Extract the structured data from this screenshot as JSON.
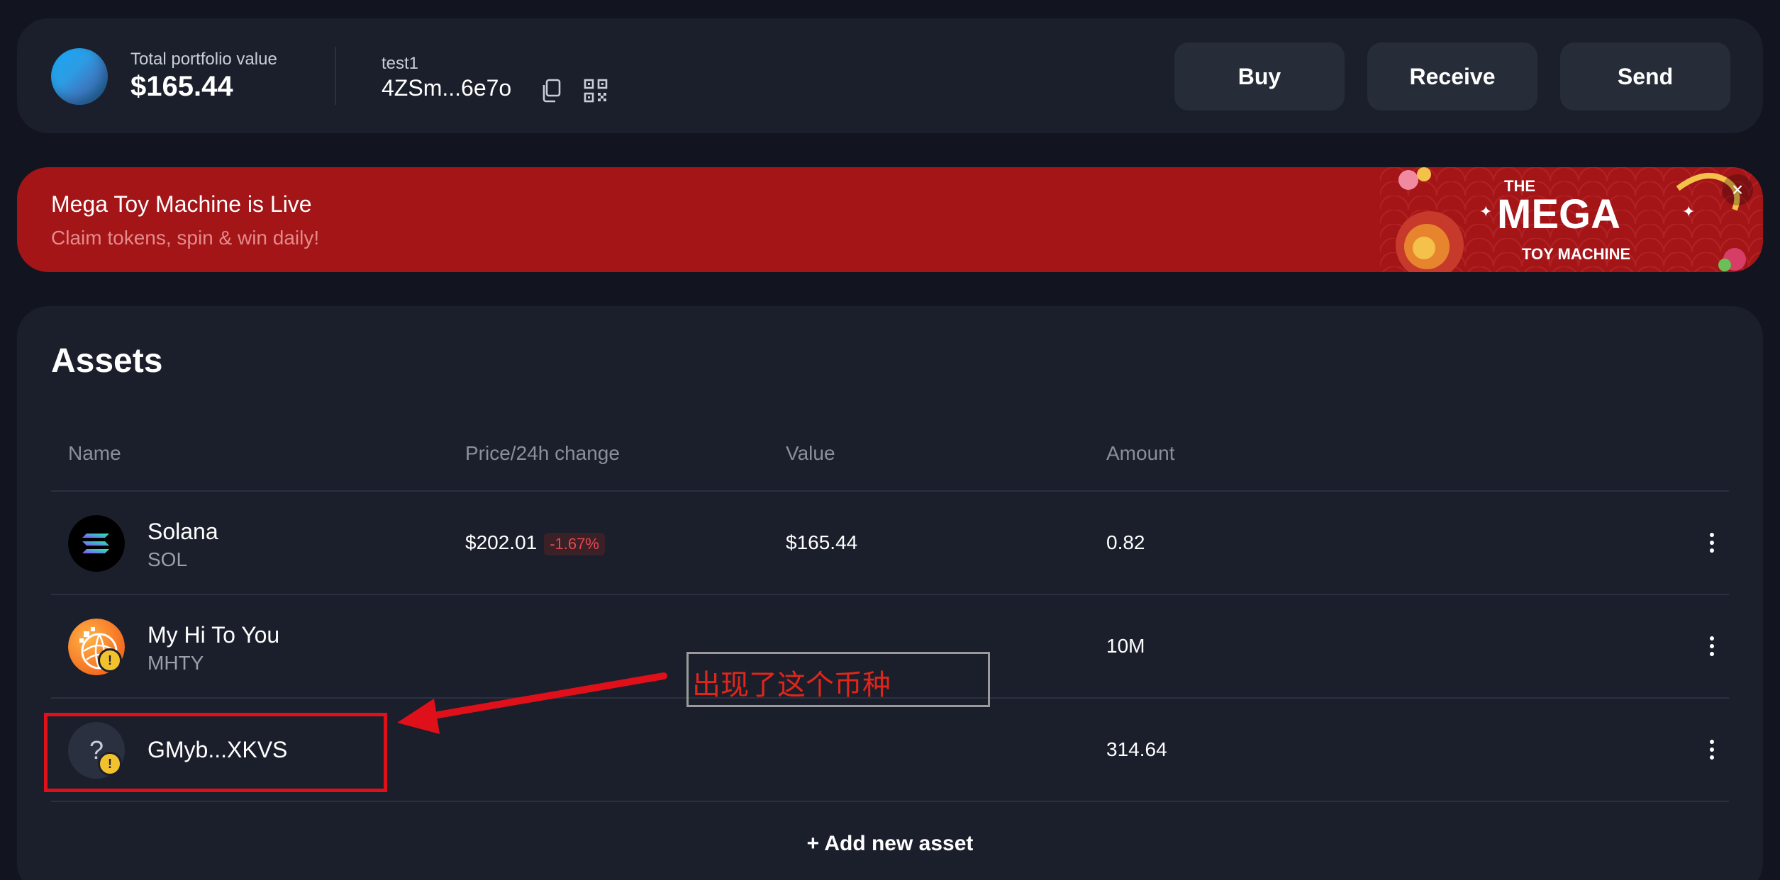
{
  "header": {
    "portfolio_label": "Total portfolio value",
    "portfolio_value": "$165.44",
    "wallet_name": "test1",
    "wallet_address": "4ZSm...6e7o",
    "buttons": {
      "buy": "Buy",
      "receive": "Receive",
      "send": "Send"
    }
  },
  "banner": {
    "title": "Mega Toy Machine is Live",
    "subtitle": "Claim tokens, spin & win daily!",
    "art_line1": "THE",
    "art_line2": "MEGA",
    "art_line3": "TOY MACHINE",
    "close_glyph": "×"
  },
  "assets": {
    "title": "Assets",
    "columns": {
      "name": "Name",
      "price": "Price/24h change",
      "value": "Value",
      "amount": "Amount"
    },
    "rows": [
      {
        "name": "Solana",
        "symbol": "SOL",
        "price": "$202.01",
        "change": "-1.67%",
        "value": "$165.44",
        "amount": "0.82",
        "icon": "solana-icon"
      },
      {
        "name": "My Hi To You",
        "symbol": "MHTY",
        "price": "",
        "change": "",
        "value": "",
        "amount": "10M",
        "icon": "mhty-token-icon",
        "warning": "!"
      },
      {
        "name": "GMyb...XKVS",
        "symbol": "",
        "price": "",
        "change": "",
        "value": "",
        "amount": "314.64",
        "icon": "unknown-token-icon",
        "icon_glyph": "?",
        "warning": "!"
      }
    ],
    "add_label": "+ Add new asset"
  },
  "annotation": {
    "text": "出现了这个币种",
    "color": "#e0261b"
  },
  "colors": {
    "background": "#121520",
    "card": "#1b1f2b",
    "button": "#272c39",
    "banner": "#a41518",
    "negative": "#e5484d",
    "warning": "#f2c12e"
  }
}
